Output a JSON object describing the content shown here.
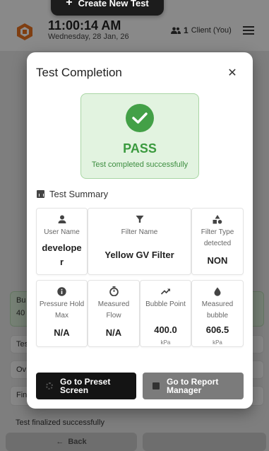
{
  "background": {
    "create_button": "Create New Test",
    "clock": "11:00:14 AM",
    "date": "Wednesday, 28 Jan, 26",
    "client_count": "1",
    "client_label": "Client (You)",
    "rows": [
      {
        "text": "Bu",
        "text2": "40"
      },
      {
        "text": "Tes"
      },
      {
        "text": "Ov"
      },
      {
        "text": "Fin"
      },
      {
        "text": "Test finalized successfully"
      }
    ],
    "back_label": "Back"
  },
  "modal": {
    "title": "Test Completion",
    "close_glyph": "✕",
    "result": {
      "status": "PASS",
      "message": "Test completed successfully",
      "color": "#43a047"
    },
    "summary_title": "Test Summary",
    "cards_top": [
      {
        "icon": "person-icon",
        "label": "User Name",
        "value": "develope\nr"
      },
      {
        "icon": "filter-icon",
        "label": "Filter Name",
        "value": "Yellow GV Filter"
      },
      {
        "icon": "shapes-icon",
        "label": "Filter Type detected",
        "value": "NON"
      }
    ],
    "cards_bottom": [
      {
        "icon": "info-icon",
        "label": "Pressure Hold Max",
        "value": "N/A",
        "unit": ""
      },
      {
        "icon": "timer-icon",
        "label": "Measured Flow",
        "value": "N/A",
        "unit": ""
      },
      {
        "icon": "trend-icon",
        "label": "Bubble Point",
        "value": "400.0",
        "unit": "kPa"
      },
      {
        "icon": "drop-icon",
        "label": "Measured bubble",
        "value": "606.5",
        "unit": "kPa"
      }
    ],
    "preset_button": "Go to Preset Screen",
    "report_button": "Go to Report Manager"
  }
}
